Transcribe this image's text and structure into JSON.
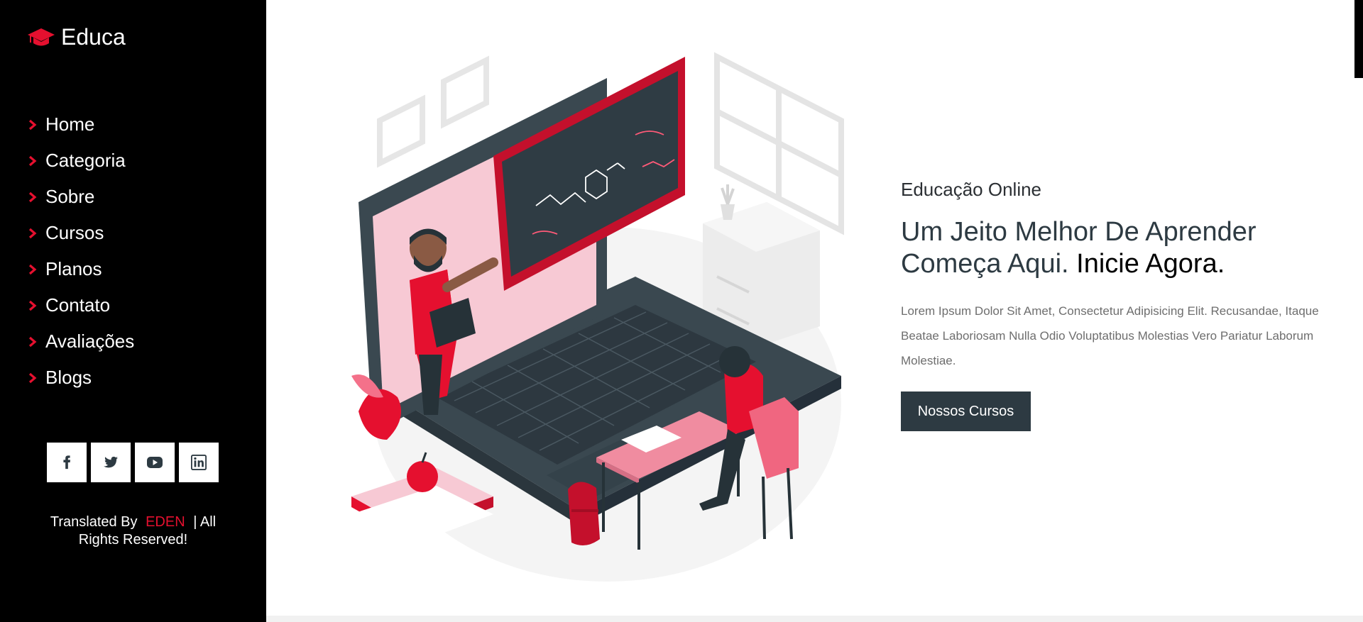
{
  "brand": {
    "name": "Educa",
    "accent": "#e5102f"
  },
  "nav": {
    "items": [
      {
        "label": "Home"
      },
      {
        "label": "Categoria"
      },
      {
        "label": "Sobre"
      },
      {
        "label": "Cursos"
      },
      {
        "label": "Planos"
      },
      {
        "label": "Contato"
      },
      {
        "label": "Avaliações"
      },
      {
        "label": "Blogs"
      }
    ]
  },
  "socials": [
    "facebook-icon",
    "twitter-icon",
    "youtube-icon",
    "linkedin-icon"
  ],
  "footer": {
    "prefix": "Translated By",
    "brand": "EDEN",
    "suffix": "| All Rights Reserved!"
  },
  "hero": {
    "eyebrow": "Educação Online",
    "title_part1": "Um Jeito Melhor De Aprender Começa Aqui.",
    "title_part2": "Inicie Agora.",
    "description": "Lorem Ipsum Dolor Sit Amet, Consectetur Adipisicing Elit. Recusandae, Itaque Beatae Laboriosam Nulla Odio Voluptatibus Molestias Vero Pariatur Laborum Molestiae.",
    "cta": "Nossos Cursos"
  },
  "colors": {
    "sidebar_bg": "#000000",
    "button_bg": "#2d3a42",
    "accent": "#e5102f"
  }
}
